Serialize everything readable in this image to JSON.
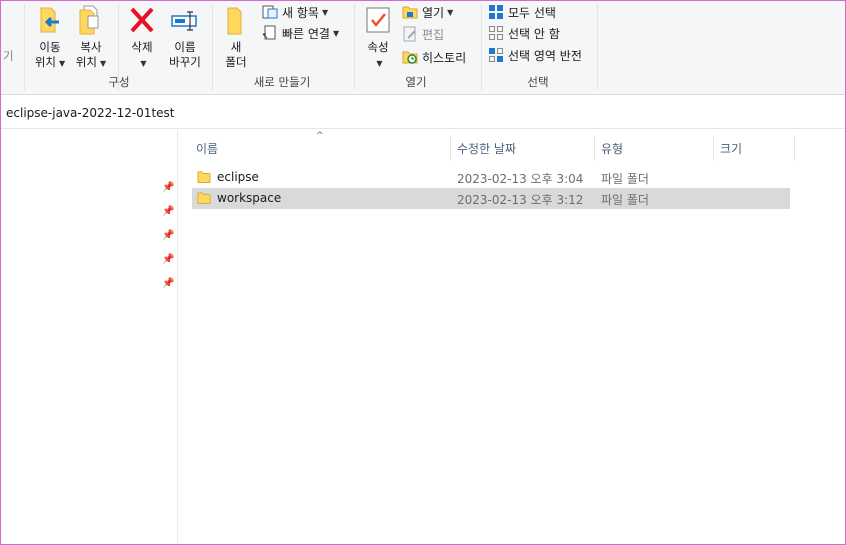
{
  "ribbon": {
    "cut_label": "기",
    "organize": {
      "label": "구성",
      "move_to": [
        "이동",
        "위치"
      ],
      "copy_to": [
        "복사",
        "위치"
      ],
      "delete": "삭제",
      "rename": [
        "이름",
        "바꾸기"
      ]
    },
    "new": {
      "label": "새로 만들기",
      "new_folder": [
        "새",
        "폴더"
      ],
      "new_item": "새 항목",
      "easy_access": "빠른 연결"
    },
    "open": {
      "label": "열기",
      "properties": "속성",
      "open": "열기",
      "edit": "편집",
      "history": "히스토리"
    },
    "select": {
      "label": "선택",
      "select_all": "모두 선택",
      "select_none": "선택 안 함",
      "invert": "선택 영역 반전"
    }
  },
  "address": {
    "path": "eclipse-java-2022-12-01test"
  },
  "columns": {
    "name": "이름",
    "modified": "수정한 날짜",
    "type": "유형",
    "size": "크기"
  },
  "files": [
    {
      "name": "eclipse",
      "modified": "2023-02-13 오후 3:04",
      "type": "파일 폴더",
      "selected": false
    },
    {
      "name": "workspace",
      "modified": "2023-02-13 오후 3:12",
      "type": "파일 폴더",
      "selected": true
    }
  ],
  "colors": {
    "folder_yellow": "#ffd75e",
    "delete_red": "#e81123",
    "selection": "#d9d9d9",
    "accent_blue": "#1e77d3"
  }
}
